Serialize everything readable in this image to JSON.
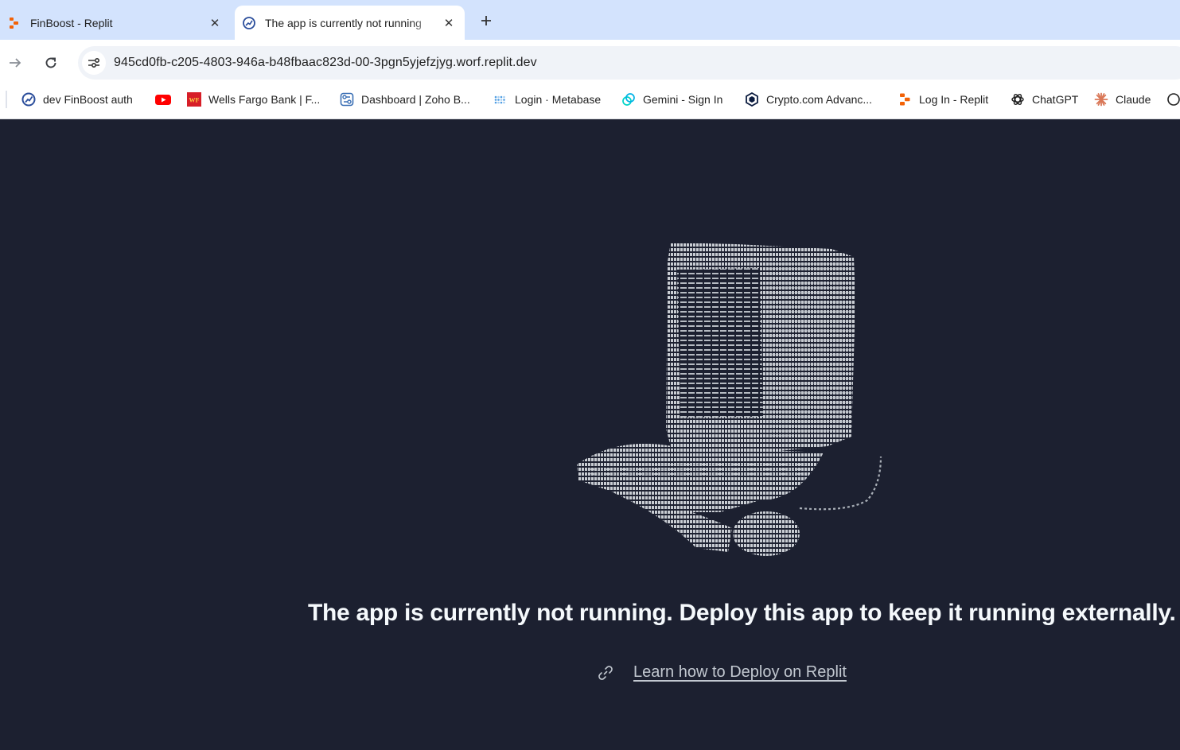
{
  "browser": {
    "tabs": [
      {
        "title": "FinBoost - Replit",
        "icon": "replit-icon",
        "active": false
      },
      {
        "title": "The app is currently not running",
        "icon": "finboost-icon",
        "active": true
      }
    ],
    "url": "945cd0fb-c205-4803-946a-b48fbaac823d-00-3pgn5yjefzjyg.worf.replit.dev"
  },
  "bookmarks": [
    {
      "label": "dev FinBoost auth",
      "icon": "finboost-icon"
    },
    {
      "label": "",
      "icon": "youtube-icon"
    },
    {
      "label": "Wells Fargo Bank | F...",
      "icon": "wells-fargo-icon"
    },
    {
      "label": "Dashboard | Zoho B...",
      "icon": "zoho-icon"
    },
    {
      "label": "Login · Metabase",
      "icon": "metabase-icon"
    },
    {
      "label": "Gemini - Sign In",
      "icon": "gemini-icon"
    },
    {
      "label": "Crypto.com Advanc...",
      "icon": "crypto-com-icon"
    },
    {
      "label": "Log In - Replit",
      "icon": "replit-icon"
    },
    {
      "label": "ChatGPT",
      "icon": "chatgpt-icon"
    },
    {
      "label": "Claude",
      "icon": "claude-icon"
    }
  ],
  "page": {
    "headline": "The app is currently not running. Deploy this app to keep it running externally.",
    "link_text": "Learn how to Deploy on Replit",
    "illustration": "ascii-art-computer-icon"
  },
  "colors": {
    "page_bg": "#1c2030",
    "tabstrip_bg": "#d3e3fd",
    "headline": "#f5f9fc",
    "link": "#c2c8d0"
  }
}
